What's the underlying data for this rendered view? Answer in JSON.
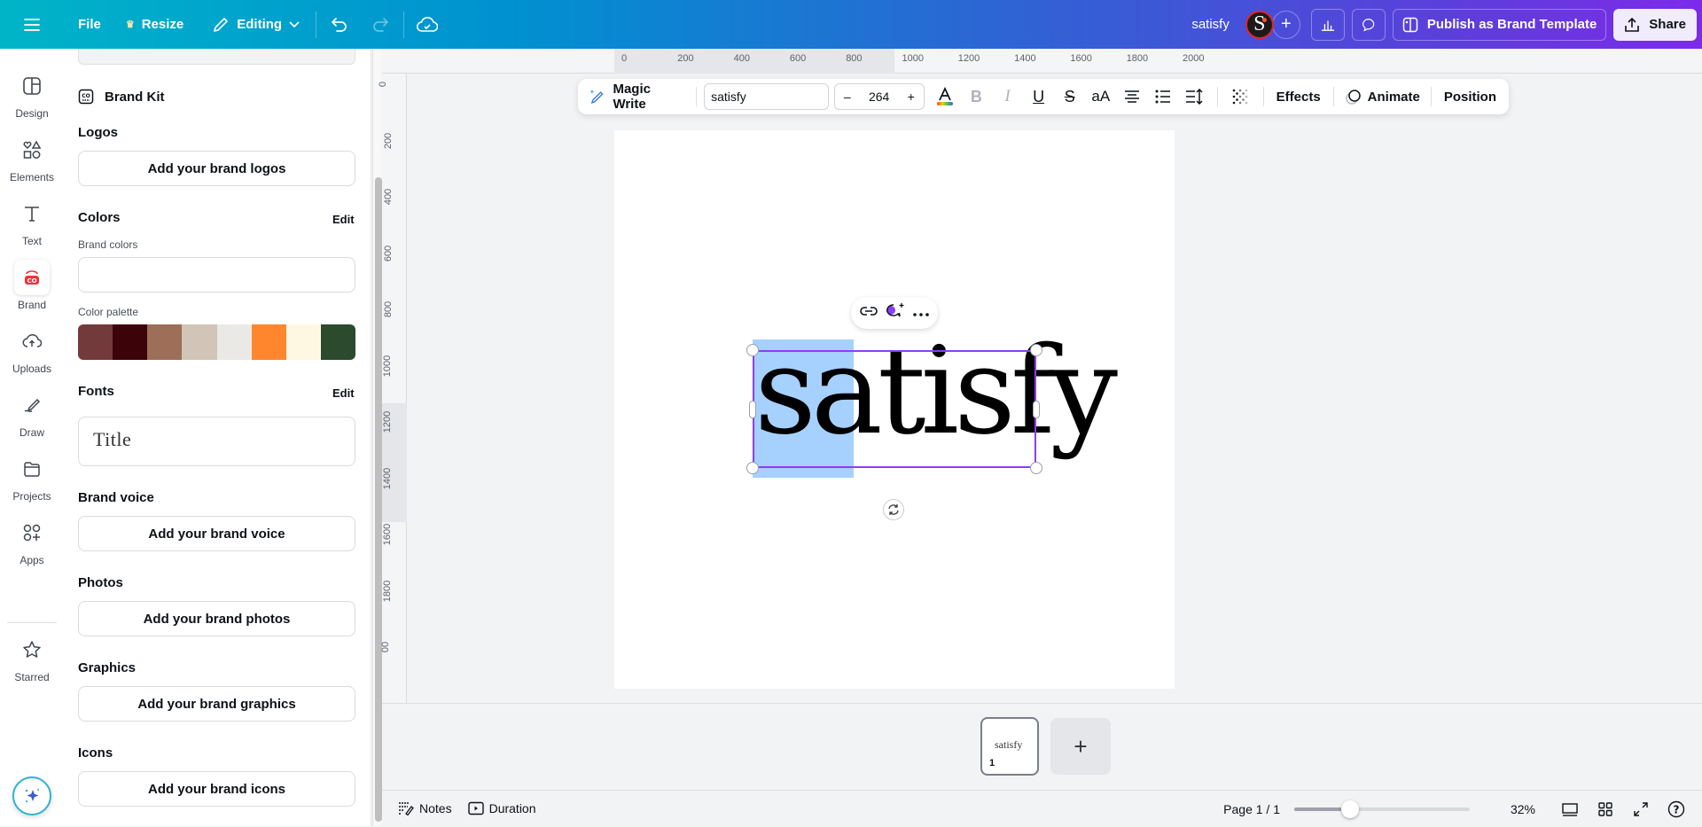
{
  "topbar": {
    "menu_icon": "hamburger-icon",
    "file": "File",
    "resize": "Resize",
    "editing": "Editing",
    "doc_title": "satisfy",
    "avatar_initial": "S",
    "publish": "Publish as Brand Template",
    "share": "Share"
  },
  "rail": {
    "items": [
      {
        "label": "Design",
        "icon": "design-icon"
      },
      {
        "label": "Elements",
        "icon": "elements-icon"
      },
      {
        "label": "Text",
        "icon": "text-icon"
      },
      {
        "label": "Brand",
        "icon": "brand-icon",
        "active": true
      },
      {
        "label": "Uploads",
        "icon": "uploads-icon"
      },
      {
        "label": "Draw",
        "icon": "draw-icon"
      },
      {
        "label": "Projects",
        "icon": "projects-icon"
      },
      {
        "label": "Apps",
        "icon": "apps-icon"
      },
      {
        "label": "Starred",
        "icon": "star-icon"
      }
    ]
  },
  "panel": {
    "brand_kit": "Brand Kit",
    "logos": {
      "title": "Logos",
      "button": "Add your brand logos"
    },
    "colors": {
      "title": "Colors",
      "edit": "Edit",
      "brand_colors_label": "Brand colors",
      "palette_label": "Color palette",
      "palette": [
        "#733a3c",
        "#3c0309",
        "#9d6e58",
        "#d0c5b7",
        "#ebe9e5",
        "#ff862d",
        "#fef8e3",
        "#2b4a2e"
      ]
    },
    "fonts": {
      "title": "Fonts",
      "edit": "Edit",
      "sample": "Title"
    },
    "brand_voice": {
      "title": "Brand voice",
      "button": "Add your brand voice"
    },
    "photos": {
      "title": "Photos",
      "button": "Add your brand photos"
    },
    "graphics": {
      "title": "Graphics",
      "button": "Add your brand graphics"
    },
    "icons": {
      "title": "Icons",
      "button": "Add your brand icons"
    }
  },
  "ruler": {
    "top": [
      "0",
      "200",
      "400",
      "600",
      "800",
      "1000",
      "1200",
      "1400",
      "1600",
      "1800",
      "2000"
    ],
    "left": [
      "0",
      "200",
      "400",
      "600",
      "800",
      "1000",
      "1200",
      "1400",
      "1600",
      "1800",
      "00"
    ]
  },
  "text_toolbar": {
    "magic_write": "Magic Write",
    "font": "satisfy",
    "size": "264",
    "minus": "–",
    "plus": "+",
    "effects": "Effects",
    "animate": "Animate",
    "position": "Position"
  },
  "canvas": {
    "text": "satisfy",
    "selected_text": "sa"
  },
  "pages": {
    "thumb_text": "satisfy",
    "thumb_number": "1",
    "add": "+"
  },
  "footer": {
    "notes": "Notes",
    "duration": "Duration",
    "page_indicator": "Page 1 / 1",
    "zoom_percent": "32%",
    "zoom_fraction": 0.32
  }
}
